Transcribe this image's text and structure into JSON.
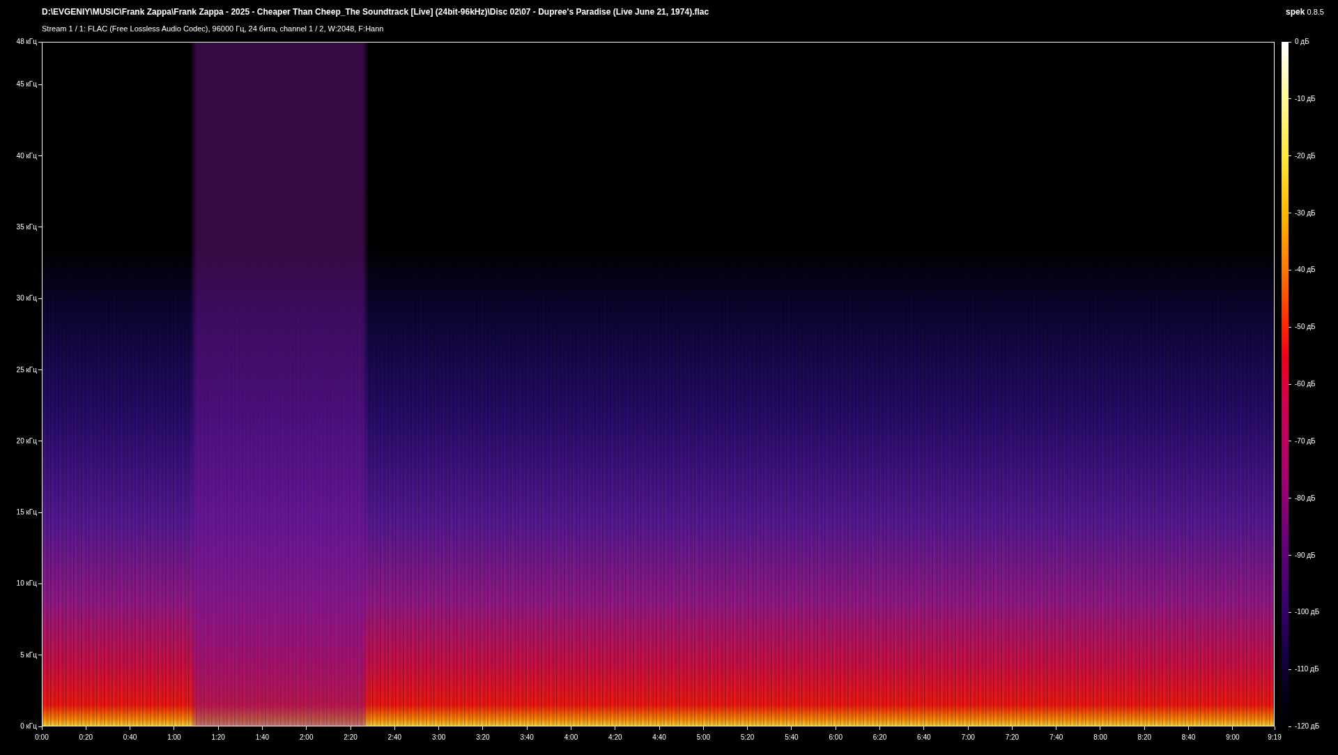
{
  "header": {
    "file_path": "D:\\EVGENIY\\MUSIC\\Frank Zappa\\Frank Zappa - 2025 - Cheaper Than Cheep_The Soundtrack [Live] (24bit-96kHz)\\Disc 02\\07 - Dupree's Paradise (Live June 21, 1974).flac",
    "stream_info": "Stream 1 / 1: FLAC (Free Lossless Audio Codec), 96000 Гц, 24 бита, channel 1 / 2, W:2048, F:Hann",
    "app_name": "**spek** 0.8.5"
  },
  "frequency_axis": [
    "48 кГц",
    "45 кГц",
    "40 кГц",
    "35 кГц",
    "30 кГц",
    "25 кГц",
    "20 кГц",
    "15 кГц",
    "10 кГц",
    "5 кГц",
    "0 кГц"
  ],
  "time_axis": [
    "0:00",
    "0:20",
    "0:40",
    "1:00",
    "1:20",
    "1:40",
    "2:00",
    "2:20",
    "2:40",
    "3:00",
    "3:20",
    "3:40",
    "4:00",
    "4:20",
    "4:40",
    "5:00",
    "5:20",
    "5:40",
    "6:00",
    "6:20",
    "6:40",
    "7:00",
    "7:20",
    "7:40",
    "8:00",
    "8:20",
    "8:40",
    "9:00",
    "9:19"
  ],
  "level_scale": [
    "0 дБ",
    "-10 дБ",
    "-20 дБ",
    "-30 дБ",
    "-40 дБ",
    "-50 дБ",
    "-60 дБ",
    "-70 дБ",
    "-80 дБ",
    "-90 дБ",
    "-100 дБ",
    "-110 дБ",
    "-120 дБ"
  ]
}
